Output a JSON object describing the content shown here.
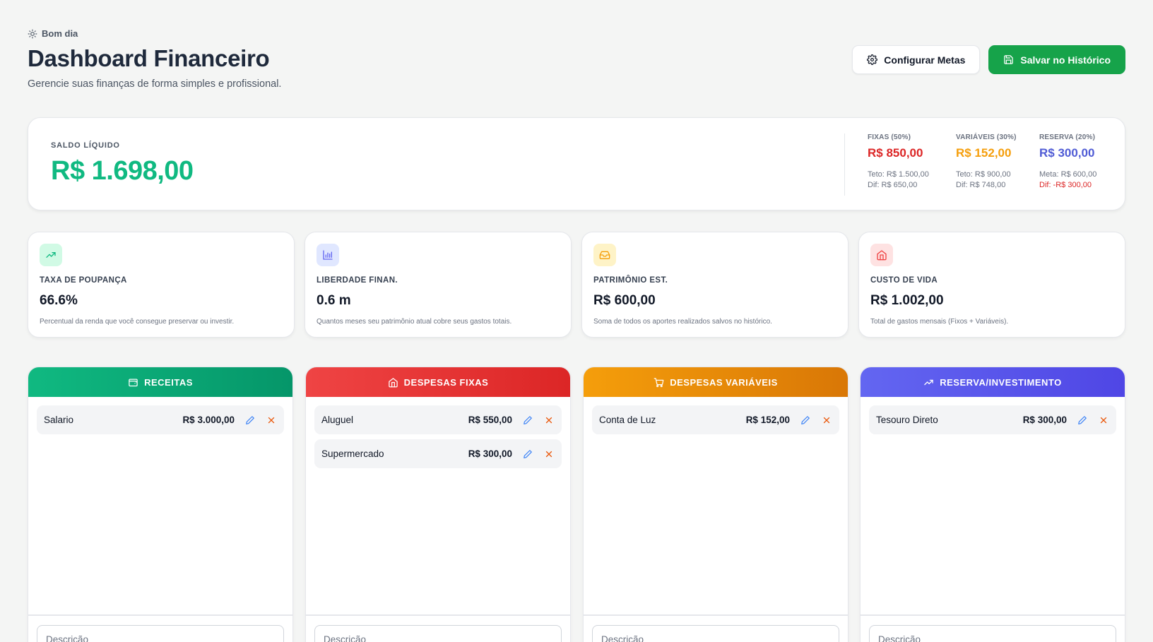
{
  "header": {
    "greeting": "Bom dia",
    "title": "Dashboard Financeiro",
    "subtitle": "Gerencie suas finanças de forma simples e profissional.",
    "configure_label": "Configurar Metas",
    "save_label": "Salvar no Histórico"
  },
  "summary": {
    "saldo_label": "SALDO LÍQUIDO",
    "saldo_value": "R$ 1.698,00",
    "budgets": [
      {
        "label": "FIXAS (50%)",
        "value": "R$ 850,00",
        "line1": "Teto: R$ 1.500,00",
        "line2": "Dif: R$ 650,00",
        "color": "#dc2626"
      },
      {
        "label": "VARIÁVEIS (30%)",
        "value": "R$ 152,00",
        "line1": "Teto: R$ 900,00",
        "line2": "Dif: R$ 748,00",
        "color": "#f59e0b"
      },
      {
        "label": "RESERVA (20%)",
        "value": "R$ 300,00",
        "line1": "Meta: R$ 600,00",
        "line2": "Dif: -R$ 300,00",
        "color": "#4f5bd5"
      }
    ]
  },
  "kpis": [
    {
      "label": "TAXA DE POUPANÇA",
      "value": "66.6%",
      "desc": "Percentual da renda que você consegue preservar ou investir.",
      "icon": "trending-up-icon"
    },
    {
      "label": "LIBERDADE FINAN.",
      "value": "0.6 m",
      "desc": "Quantos meses seu patrimônio atual cobre seus gastos totais.",
      "icon": "bar-chart-icon"
    },
    {
      "label": "PATRIMÔNIO EST.",
      "value": "R$ 600,00",
      "desc": "Soma de todos os aportes realizados salvos no histórico.",
      "icon": "inbox-icon"
    },
    {
      "label": "CUSTO DE VIDA",
      "value": "R$ 1.002,00",
      "desc": "Total de gastos mensais (Fixos + Variáveis).",
      "icon": "home-icon"
    }
  ],
  "columns": [
    {
      "title": "RECEITAS",
      "icon": "wallet-icon",
      "entries": [
        {
          "desc": "Salario",
          "amount": "R$ 3.000,00"
        }
      ]
    },
    {
      "title": "DESPESAS FIXAS",
      "icon": "home-icon",
      "entries": [
        {
          "desc": "Aluguel",
          "amount": "R$ 550,00"
        },
        {
          "desc": "Supermercado",
          "amount": "R$ 300,00"
        }
      ]
    },
    {
      "title": "DESPESAS VARIÁVEIS",
      "icon": "cart-icon",
      "entries": [
        {
          "desc": "Conta de Luz",
          "amount": "R$ 152,00"
        }
      ]
    },
    {
      "title": "RESERVA/INVESTIMENTO",
      "icon": "trending-up-icon",
      "entries": [
        {
          "desc": "Tesouro Direto",
          "amount": "R$ 300,00"
        }
      ]
    }
  ],
  "input_placeholder": "Descrição",
  "colors": {
    "accent_green": "#16a34a",
    "saldo": "#10b981",
    "receitas": "#10b981",
    "fixas": "#ef4444",
    "variaveis": "#f59e0b",
    "reserva": "#6366f1"
  }
}
